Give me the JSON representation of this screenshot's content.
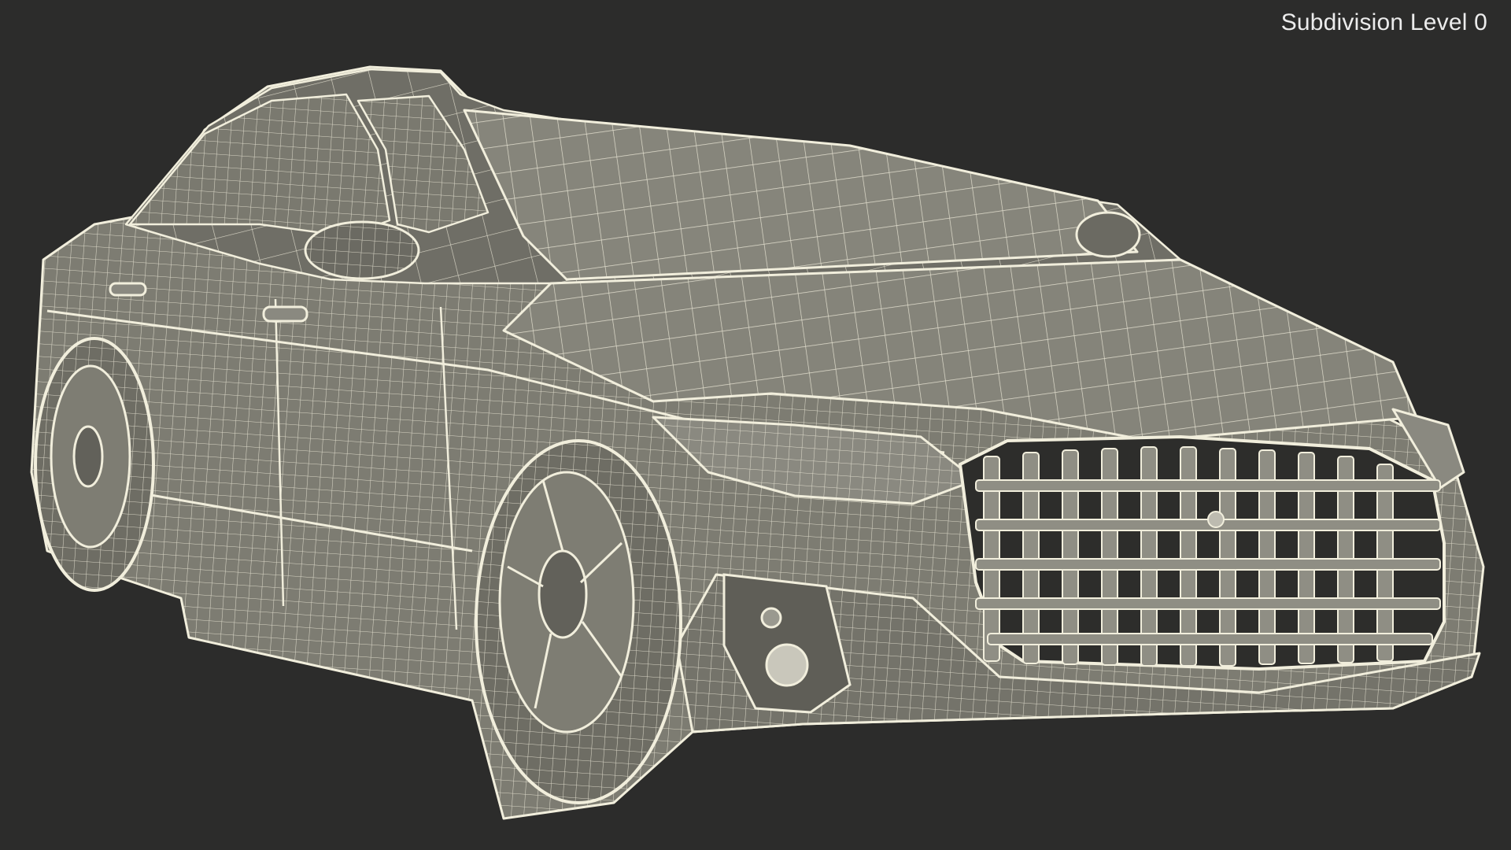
{
  "viewport": {
    "label": "Subdivision Level 0",
    "colors": {
      "background": "#2c2c2b",
      "surface": "#7d7c72",
      "surface_dark": "#5d5c54",
      "wire": "#f1eedc",
      "label": "#ececec"
    },
    "subject": "sedan-wireframe-icon"
  }
}
